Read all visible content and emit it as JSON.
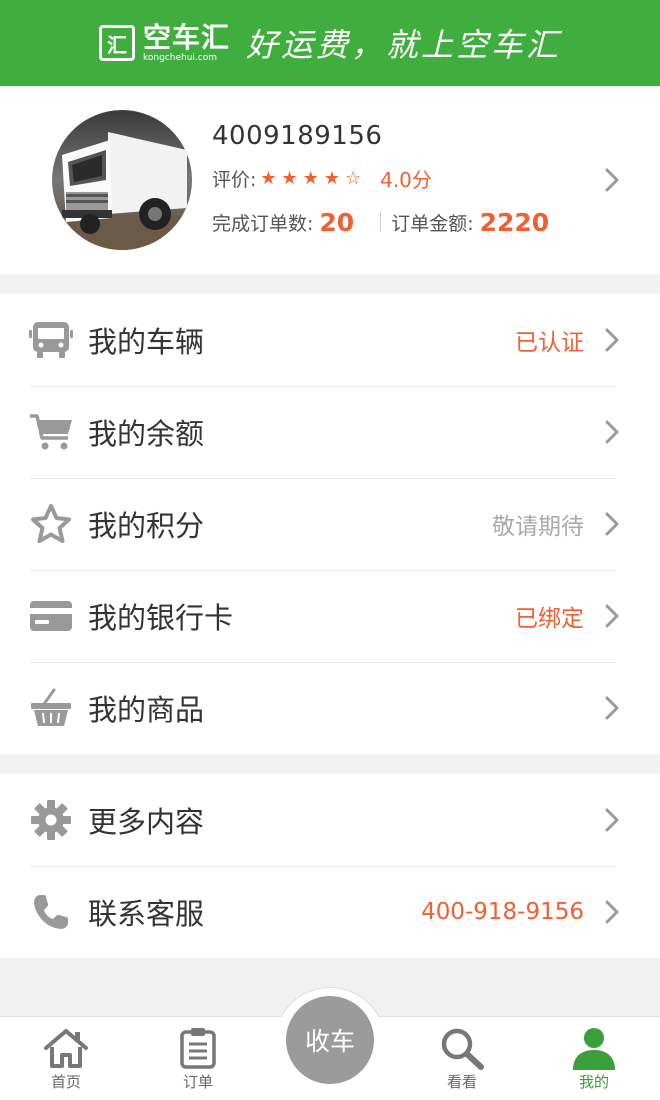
{
  "header": {
    "logo_mark": "汇",
    "logo_text": "空车汇",
    "logo_domain": "kongchehui.com",
    "slogan": "好运费，就上空车汇"
  },
  "profile": {
    "phone": "4009189156",
    "rating_label": "评价:",
    "stars": "★★★★☆",
    "rating_value": 4.0,
    "rating_score": "4.0分",
    "orders_label": "完成订单数:",
    "orders_value": "20",
    "amount_label": "订单金额:",
    "amount_value": "2220"
  },
  "menu_group_1": [
    {
      "icon": "bus-icon",
      "label": "我的车辆",
      "value": "已认证",
      "value_style": "orange"
    },
    {
      "icon": "cart-icon",
      "label": "我的余额",
      "value": "",
      "value_style": ""
    },
    {
      "icon": "star-icon",
      "label": "我的积分",
      "value": "敬请期待",
      "value_style": "gray"
    },
    {
      "icon": "bank-card-icon",
      "label": "我的银行卡",
      "value": "已绑定",
      "value_style": "orange"
    },
    {
      "icon": "basket-icon",
      "label": "我的商品",
      "value": "",
      "value_style": ""
    }
  ],
  "menu_group_2": [
    {
      "icon": "gear-icon",
      "label": "更多内容",
      "value": "",
      "value_style": ""
    },
    {
      "icon": "phone-icon",
      "label": "联系客服",
      "value": "400-918-9156",
      "value_style": "orange"
    }
  ],
  "tabbar": {
    "items": [
      {
        "icon": "home-icon",
        "label": "首页"
      },
      {
        "icon": "clipboard-icon",
        "label": "订单"
      },
      {
        "icon": "",
        "label": "收车"
      },
      {
        "icon": "search-icon",
        "label": "看看"
      },
      {
        "icon": "user-icon",
        "label": "我的"
      }
    ],
    "active_index": 4
  },
  "colors": {
    "brand_green": "#3fae3f",
    "accent_orange": "#f06030",
    "muted_gray": "#aaaaaa"
  }
}
